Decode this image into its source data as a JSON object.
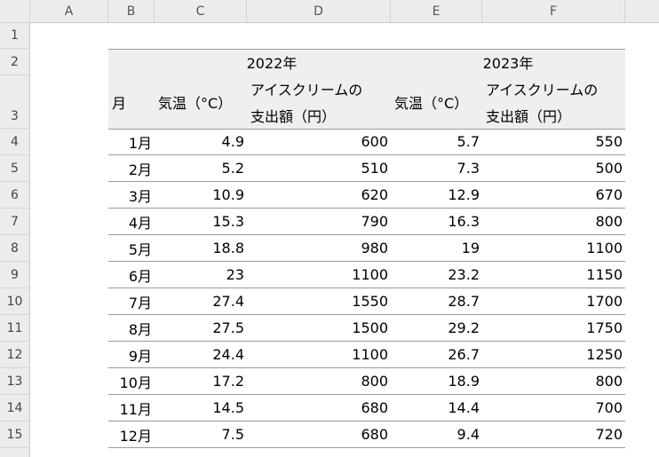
{
  "columns": [
    "A",
    "B",
    "C",
    "D",
    "E",
    "F"
  ],
  "rows": [
    "1",
    "2",
    "3",
    "4",
    "5",
    "6",
    "7",
    "8",
    "9",
    "10",
    "11",
    "12",
    "13",
    "14",
    "15"
  ],
  "headers": {
    "year_2022": "2022年",
    "year_2023": "2023年",
    "month": "月",
    "temp_2022": "気温（°C）",
    "ice_2022_line1": "アイスクリームの",
    "ice_2022_line2": "支出額（円）",
    "temp_2023": "気温（°C）",
    "ice_2023_line1": "アイスクリームの",
    "ice_2023_line2": "支出額（円）"
  },
  "data": [
    {
      "month": "1月",
      "t22": "4.9",
      "i22": "600",
      "t23": "5.7",
      "i23": "550"
    },
    {
      "month": "2月",
      "t22": "5.2",
      "i22": "510",
      "t23": "7.3",
      "i23": "500"
    },
    {
      "month": "3月",
      "t22": "10.9",
      "i22": "620",
      "t23": "12.9",
      "i23": "670"
    },
    {
      "month": "4月",
      "t22": "15.3",
      "i22": "790",
      "t23": "16.3",
      "i23": "800"
    },
    {
      "month": "5月",
      "t22": "18.8",
      "i22": "980",
      "t23": "19",
      "i23": "1100"
    },
    {
      "month": "6月",
      "t22": "23",
      "i22": "1100",
      "t23": "23.2",
      "i23": "1150"
    },
    {
      "month": "7月",
      "t22": "27.4",
      "i22": "1550",
      "t23": "28.7",
      "i23": "1700"
    },
    {
      "month": "8月",
      "t22": "27.5",
      "i22": "1500",
      "t23": "29.2",
      "i23": "1750"
    },
    {
      "month": "9月",
      "t22": "24.4",
      "i22": "1100",
      "t23": "26.7",
      "i23": "1250"
    },
    {
      "month": "10月",
      "t22": "17.2",
      "i22": "800",
      "t23": "18.9",
      "i23": "800"
    },
    {
      "month": "11月",
      "t22": "14.5",
      "i22": "680",
      "t23": "14.4",
      "i23": "700"
    },
    {
      "month": "12月",
      "t22": "7.5",
      "i22": "680",
      "t23": "9.4",
      "i23": "720"
    }
  ]
}
